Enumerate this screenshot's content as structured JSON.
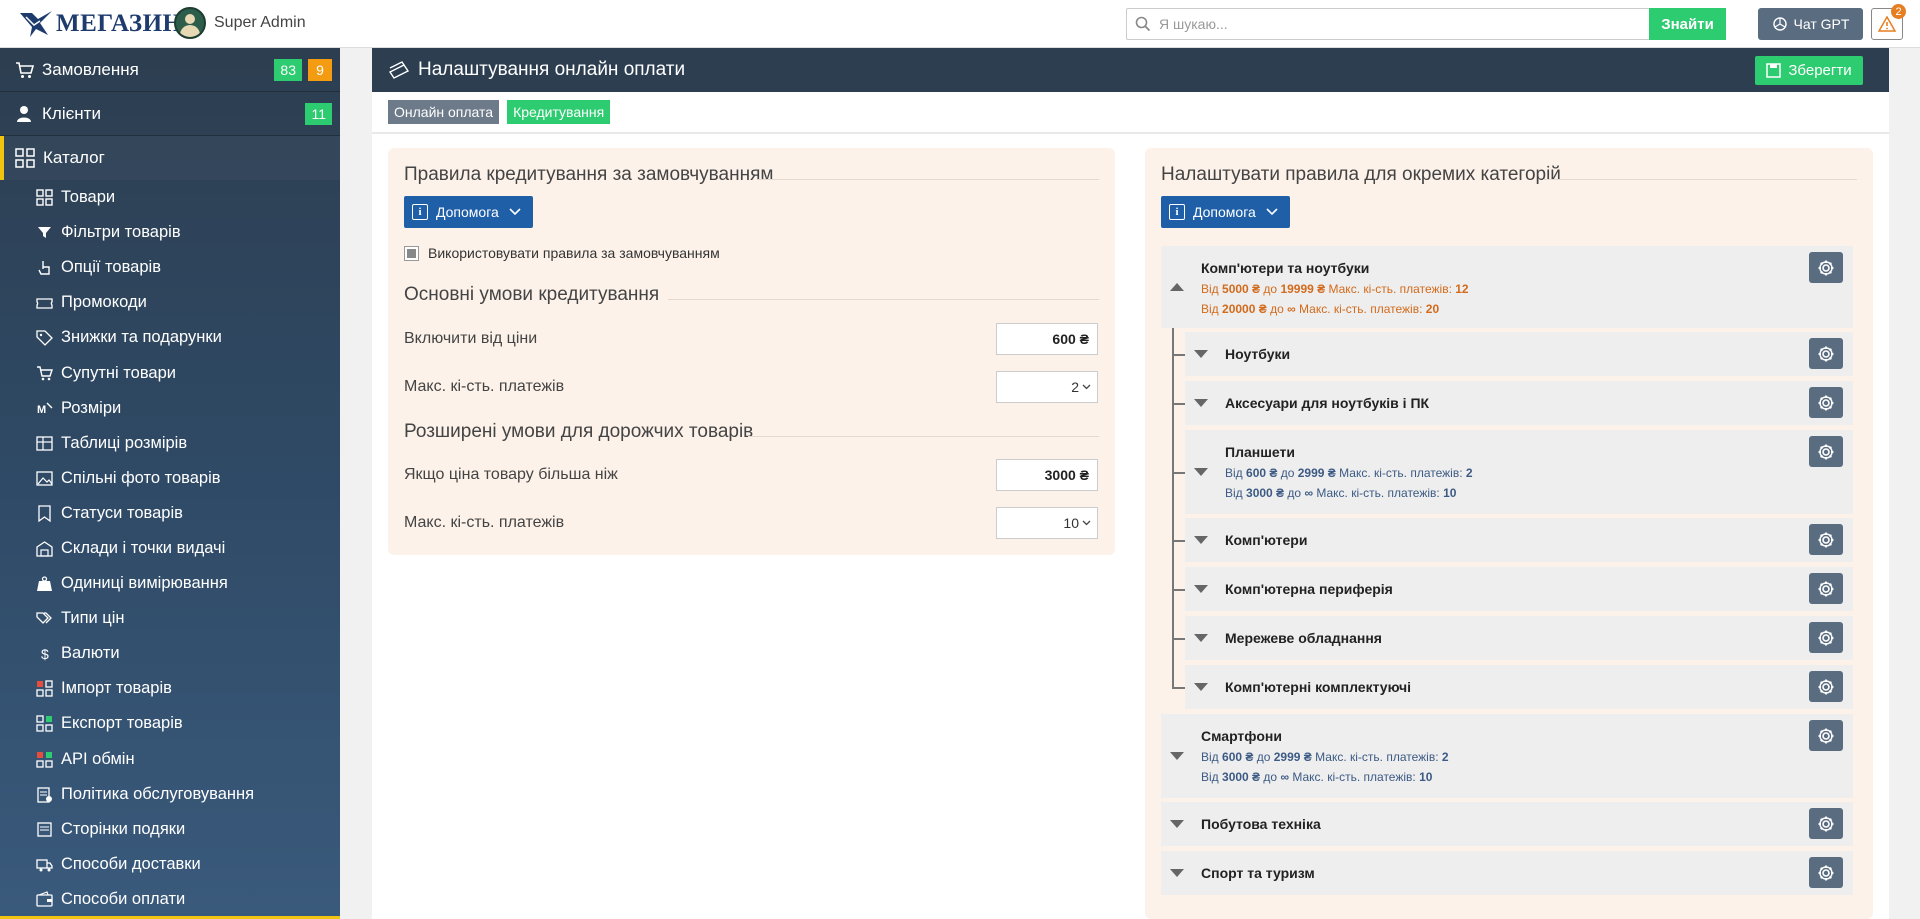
{
  "header": {
    "logo_text": "МЕГАЗИН",
    "user_name": "Super Admin",
    "search_placeholder": "Я шукаю...",
    "search_button": "Знайти",
    "gpt_button": "Чат GPT",
    "alerts_count": "2"
  },
  "sidebar": {
    "orders": {
      "label": "Замовлення",
      "badge_green": "83",
      "badge_orange": "9"
    },
    "clients": {
      "label": "Клієнти",
      "badge_green": "11"
    },
    "catalog": {
      "label": "Каталог"
    },
    "items": [
      {
        "label": "Товари",
        "icon": "grid-icon"
      },
      {
        "label": "Фільтри товарів",
        "icon": "filter-icon"
      },
      {
        "label": "Опції товарів",
        "icon": "hand-pointer-icon"
      },
      {
        "label": "Промокоди",
        "icon": "ticket-icon"
      },
      {
        "label": "Знижки та подарунки",
        "icon": "percent-tag-icon"
      },
      {
        "label": "Супутні товари",
        "icon": "cart-plus-icon"
      },
      {
        "label": "Розміри",
        "icon": "ruler-icon"
      },
      {
        "label": "Таблиці розмірів",
        "icon": "table-icon"
      },
      {
        "label": "Спільні фото товарів",
        "icon": "image-icon"
      },
      {
        "label": "Статуси товарів",
        "icon": "badge-icon"
      },
      {
        "label": "Склади і точки видачі",
        "icon": "warehouse-icon"
      },
      {
        "label": "Одиниці вимірювання",
        "icon": "weight-icon"
      },
      {
        "label": "Типи цін",
        "icon": "price-tags-icon"
      },
      {
        "label": "Валюти",
        "icon": "dollar-icon"
      },
      {
        "label": "Імпорт товарів",
        "icon": "import-icon"
      },
      {
        "label": "Експорт товарів",
        "icon": "export-icon"
      },
      {
        "label": "API обмін",
        "icon": "api-icon"
      },
      {
        "label": "Політика обслуговування",
        "icon": "policy-icon"
      },
      {
        "label": "Сторінки подяки",
        "icon": "thanks-page-icon"
      },
      {
        "label": "Способи доставки",
        "icon": "truck-icon"
      },
      {
        "label": "Способи оплати",
        "icon": "wallet-icon"
      }
    ]
  },
  "page": {
    "title": "Налаштування онлайн оплати",
    "save_button": "Зберегти",
    "tabs": [
      "Онлайн оплата",
      "Кредитування"
    ]
  },
  "left_panel": {
    "title": "Правила кредитування за замовчуванням",
    "help_button": "Допомога",
    "checkbox_label": "Використовувати правила за замовчуванням",
    "basic_title": "Основні умови кредитування",
    "enable_from_label": "Включити від ціни",
    "enable_from_value": "600 ₴",
    "max_payments_label": "Макс. кі-сть. платежів",
    "max_payments_value": "2",
    "extended_title": "Розширені умови для дорожчих товарів",
    "if_price_label": "Якщо ціна товару більша ніж",
    "if_price_value": "3000 ₴",
    "max_payments2_label": "Макс. кі-сть. платежів",
    "max_payments2_value": "10"
  },
  "right_panel": {
    "title": "Налаштувати правила для окремих категорій",
    "help_button": "Допомога",
    "categories": [
      {
        "name": "Комп'ютери та ноутбуки",
        "rules": [
          {
            "from_word": "Від",
            "from": "5000 ₴",
            "to_word": "до",
            "to": "19999 ₴",
            "max_word": "Макс. кі-сть. платежів:",
            "max": "12"
          },
          {
            "from_word": "Від",
            "from": "20000 ₴",
            "to_word": "до",
            "to": "∞",
            "max_word": "Макс. кі-сть. платежів:",
            "max": "20"
          }
        ]
      },
      {
        "name": "Ноутбуки"
      },
      {
        "name": "Аксесуари для ноутбуків і ПК"
      },
      {
        "name": "Планшети",
        "rules": [
          {
            "from_word": "Від",
            "from": "600 ₴",
            "to_word": "до",
            "to": "2999 ₴",
            "max_word": "Макс. кі-сть. платежів:",
            "max": "2"
          },
          {
            "from_word": "Від",
            "from": "3000 ₴",
            "to_word": "до",
            "to": "∞",
            "max_word": "Макс. кі-сть. платежів:",
            "max": "10"
          }
        ]
      },
      {
        "name": "Комп'ютери"
      },
      {
        "name": "Комп'ютерна периферія"
      },
      {
        "name": "Мережеве обладнання"
      },
      {
        "name": "Комп'ютерні комплектуючі"
      },
      {
        "name": "Смартфони",
        "rules": [
          {
            "from_word": "Від",
            "from": "600 ₴",
            "to_word": "до",
            "to": "2999 ₴",
            "max_word": "Макс. кі-сть. платежів:",
            "max": "2"
          },
          {
            "from_word": "Від",
            "from": "3000 ₴",
            "to_word": "до",
            "to": "∞",
            "max_word": "Макс. кі-сть. платежів:",
            "max": "10"
          }
        ]
      },
      {
        "name": "Побутова техніка"
      },
      {
        "name": "Спорт та туризм"
      }
    ]
  },
  "colors": {
    "accent_green": "#2ecc71",
    "accent_orange": "#f39c12",
    "sidebar_bg": "#2d3e50",
    "help_blue": "#1f5fa8",
    "panel_bg": "#fdf2ea"
  }
}
